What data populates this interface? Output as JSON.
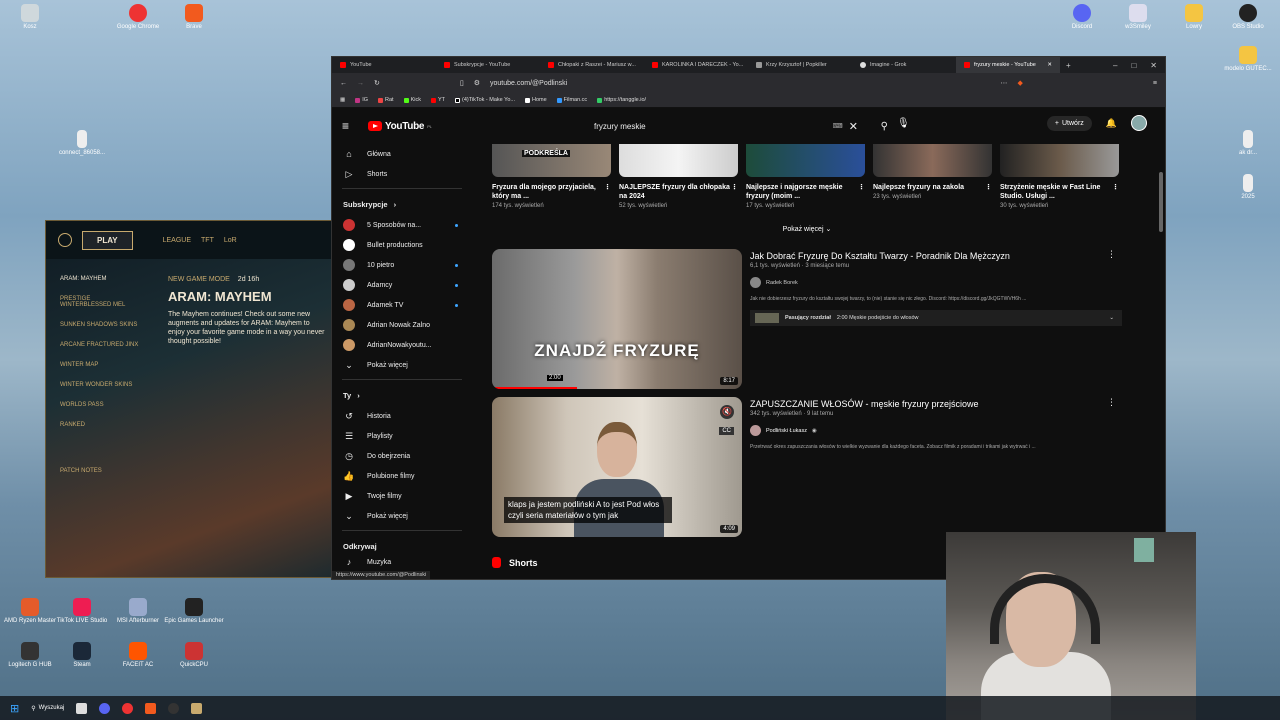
{
  "desktop": {
    "icons_left_top": [
      "Kosz",
      "Google Chrome",
      "Brave"
    ],
    "icon_mid": "connect_86058...",
    "icons_right": [
      "Discord",
      "w3Smiley",
      "Lowry",
      "OBS Studio",
      "modelo GUTEC...",
      "ak dr...",
      "2025"
    ],
    "icons_bottom": [
      "AMD Ryzen Master",
      "TikTok LIVE Studio",
      "MSI Afterburner",
      "Epic Games Launcher",
      "Logitech G HUB",
      "Steam",
      "FACEIT AC",
      "QuickCPU"
    ]
  },
  "league": {
    "play": "PLAY",
    "tabs": [
      "LEAGUE",
      "TFT",
      "LoR"
    ],
    "mode_header": "ARAM: MAYHEM",
    "menu": [
      "PRESTIGE WINTERBLESSED MEL",
      "SUNKEN SHADOWS SKINS",
      "ARCANE FRACTURED JINX",
      "WINTER MAP",
      "WINTER WONDER SKINS",
      "WORLDS PASS",
      "RANKED",
      "PATCH NOTES"
    ],
    "new_mode": "NEW GAME MODE",
    "time_left": "2d 16h",
    "title": "ARAM: MAYHEM",
    "desc": "The Mayhem continues! Check out some new augments and updates for ARAM: Mayhem to enjoy your favorite game mode in a way you never thought possible!"
  },
  "browser": {
    "tabs": [
      "YouTube",
      "Subskrypcje - YouTube",
      "Chłopaki z Raszei - Mariusz w...",
      "KAROLINKA I DARECZEK - Yo...",
      "Krzy Krzysztof | Popkiller",
      "Imagine - Grok",
      "fryzury meskie - YouTube"
    ],
    "active_tab_index": 6,
    "url": "youtube.com/@Podlinski",
    "bookmarks": [
      "IG",
      "Rat",
      "Kick",
      "YT",
      "(4)TikTok - Make Yo...",
      "Home",
      "Filman.cc",
      "https://tanggle.io/"
    ],
    "status_url": "https://www.youtube.com/@Podlinski"
  },
  "youtube": {
    "logo": "YouTube",
    "country": "PL",
    "search_value": "fryzury meskie",
    "create_label": "Utwórz",
    "sidebar": {
      "main": [
        "Główna",
        "Shorts"
      ],
      "subs_header": "Subskrypcje",
      "subs": [
        "5 Sposobów na...",
        "Bullet productions",
        "10 pietro",
        "Adamcy",
        "Adamek TV",
        "Adrian Nowak Zalno",
        "AdrianNowakyoutu..."
      ],
      "show_more": "Pokaż więcej",
      "you_header": "Ty",
      "you": [
        "Historia",
        "Playlisty",
        "Do obejrzenia",
        "Polubione filmy",
        "Twoje filmy"
      ],
      "show_more2": "Pokaż więcej",
      "explore_header": "Odkrywaj",
      "explore_first": "Muzyka"
    },
    "shelf": [
      {
        "title": "Fryzura dla mojego przyjaciela, który ma ...",
        "views": "174 tys. wyświetleń",
        "thumb_text": "PODKREŚLA"
      },
      {
        "title": "NAJLEPSZE fryzury dla chłopaka na 2024",
        "views": "52 tys. wyświetleń"
      },
      {
        "title": "Najlepsze i najgorsze męskie fryzury (moim ...",
        "views": "17 tys. wyświetleń"
      },
      {
        "title": "Najlepsze fryzury na zakola",
        "views": "23 tys. wyświetleń"
      },
      {
        "title": "Strzyżenie męskie w Fast Line Studio. Usługi ...",
        "views": "30 tys. wyświetleń"
      }
    ],
    "show_more_label": "Pokaż więcej",
    "videos": [
      {
        "title": "Jak Dobrać Fryzurę Do Kształtu Twarzy - Poradnik Dla Mężczyzn",
        "meta": "6,1 tys. wyświetleń · 3 miesiące temu",
        "channel": "Radek Borek",
        "desc": "Jak nie dobierzesz fryzury do kształtu swojej twarzy, to (nie) stanie się nic złego. Discord: https://discord.gg/JkQGTWVH6h ...",
        "chapter": "Pasujący rozdział",
        "chapter_detail": "2:00 Męskie podejście do włosów",
        "overlay": "ZNAJDŹ FRYZURĘ",
        "time_marker": "2:00",
        "duration": "8:17"
      },
      {
        "title": "ZAPUSZCZANIE WŁOSÓW - męskie fryzury przejściowe",
        "meta": "342 tys. wyświetleń · 9 lat temu",
        "channel": "Podliński Łukasz",
        "desc": "Przetrwać okres zapuszczania włosów to wielkie wyzwanie dla każdego faceta. Zobacz filmik z poradami i trikami jak wytrwać i ...",
        "caption": "klaps ja jestem podliński A to jest Pod włos czyli seria materiałów o tym jak",
        "duration": "4:09"
      }
    ],
    "shorts_label": "Shorts"
  },
  "taskbar": {
    "search": "Wyszukaj"
  },
  "colors": {
    "yt_bg": "#0f0f0f",
    "yt_red": "#ff0000",
    "league_gold": "#c8aa6e"
  }
}
